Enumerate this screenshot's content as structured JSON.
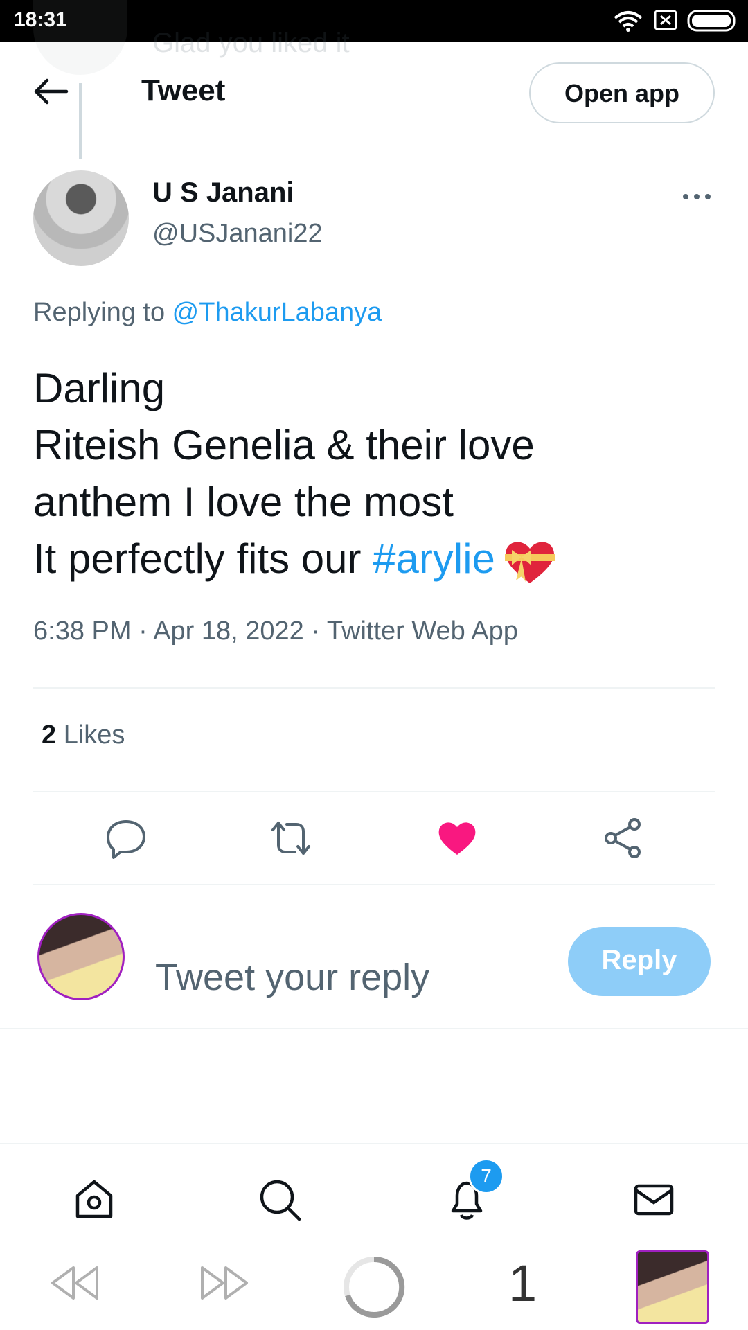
{
  "status_bar": {
    "time": "18:31"
  },
  "ghost_tweet": {
    "text": "Glad you liked it"
  },
  "header": {
    "title": "Tweet",
    "open_app_label": "Open app"
  },
  "tweet": {
    "author_name": "U S Janani",
    "author_handle": "@USJanani22",
    "replying_prefix": "Replying to ",
    "replying_to": "@ThakurLabanya",
    "lines": [
      "Darling",
      "Riteish Genelia & their love",
      "anthem I love the most",
      "It perfectly fits our "
    ],
    "hashtag": "#arylie",
    "meta": "6:38 PM · Apr 18, 2022 · Twitter Web App",
    "likes_count": "2",
    "likes_label": " Likes"
  },
  "composer": {
    "placeholder": "Tweet your reply",
    "reply_label": "Reply"
  },
  "bottom_nav": {
    "notifications_badge": "7"
  },
  "browser_bar": {
    "tab_count": "1"
  },
  "colors": {
    "accent": "#1d9bf0",
    "like": "#f91880",
    "reply_button": "#8ecdf8"
  },
  "icons": [
    "back-arrow-icon",
    "more-icon",
    "reply-icon",
    "retweet-icon",
    "heart-filled-icon",
    "share-icon",
    "home-icon",
    "search-icon",
    "bell-icon",
    "mail-icon",
    "back-icon",
    "forward-icon",
    "loading-icon"
  ]
}
